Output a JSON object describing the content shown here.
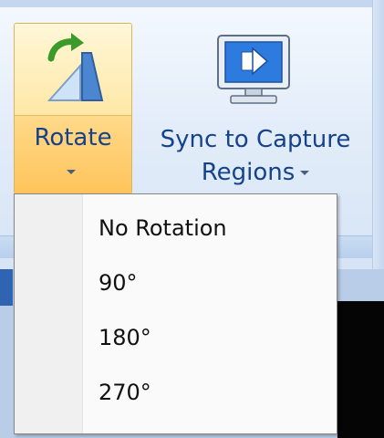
{
  "ribbon": {
    "rotate_button": {
      "label": "Rotate",
      "icon": "rotate-icon"
    },
    "sync_button": {
      "label_line1": "Sync to Capture",
      "label_line2": "Regions",
      "icon": "monitor-sync-icon"
    }
  },
  "rotate_menu": {
    "items": [
      {
        "label": "No Rotation"
      },
      {
        "label": "90°"
      },
      {
        "label": "180°"
      },
      {
        "label": "270°"
      }
    ]
  },
  "colors": {
    "ribbon_text": "#15428b",
    "highlight_top": "#fff7d8",
    "highlight_bottom": "#ffc45a",
    "menu_bg": "#fafafa"
  }
}
